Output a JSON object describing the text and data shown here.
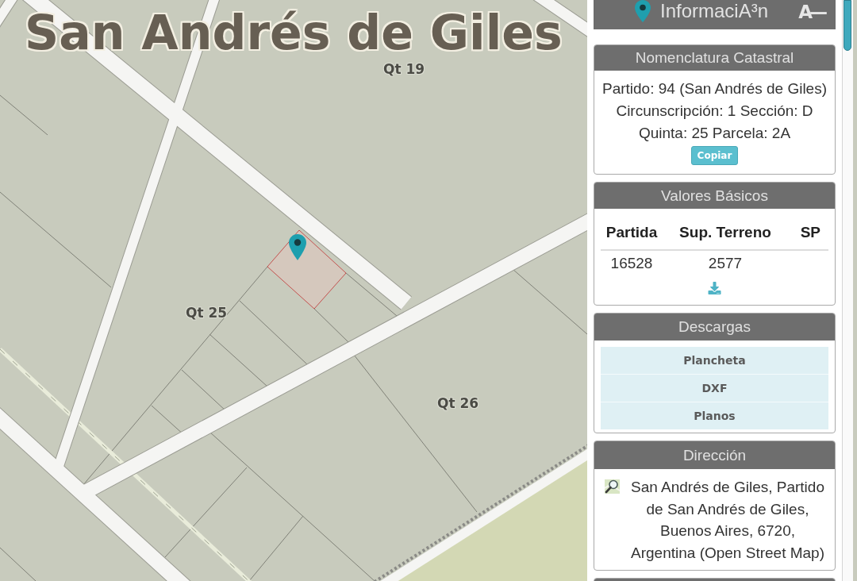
{
  "map": {
    "place_label": "San Andrés de Giles",
    "block_labels": [
      "Qt 19",
      "Qt 25",
      "Qt 26"
    ]
  },
  "sidebar": {
    "header": {
      "title": "InformaciA³n",
      "toggle": "A—"
    },
    "panels": [
      {
        "kind": "nomenclature",
        "title": "Nomenclatura Catastral",
        "lines": [
          "Partido: 94 (San Andrés de Giles)",
          "Circunscripción: 1 Sección: D",
          "Quinta: 25 Parcela: 2A"
        ],
        "button": "Copiar"
      },
      {
        "kind": "table",
        "title": "Valores Básicos",
        "columns": [
          "Partida",
          "Sup. Terreno",
          "SP"
        ],
        "rows": [
          [
            "16528",
            "2577"
          ]
        ]
      },
      {
        "kind": "downloads",
        "title": "Descargas",
        "items": [
          "Plancheta",
          "DXF",
          "Planos"
        ]
      },
      {
        "kind": "address",
        "title": "Dirección",
        "text": "San Andrés de Giles, Partido de San Andrés de Giles, Buenos Aires, 6720, Argentina (Open Street Map)"
      },
      {
        "kind": "cut_off"
      }
    ]
  }
}
